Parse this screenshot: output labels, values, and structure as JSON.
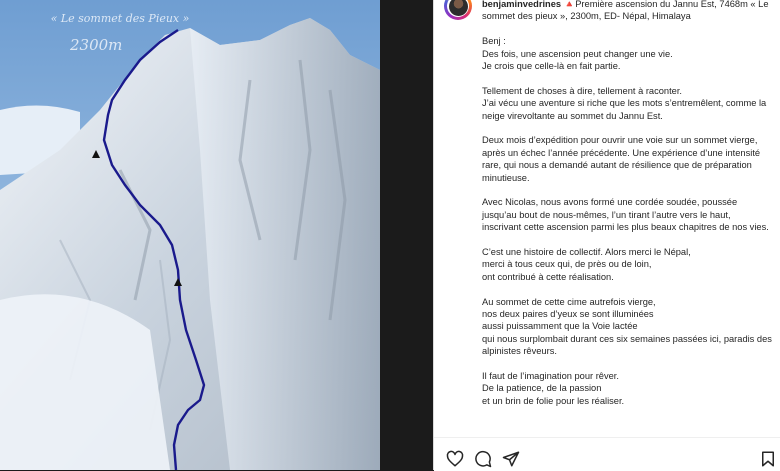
{
  "image": {
    "caption_top": "« Le sommet des Pieux »",
    "altitude_label": "2300m"
  },
  "post": {
    "username": "benjaminvedrines",
    "title_line": " 🔺Première ascension du Jannu Est, 7468m « Le sommet des pieux », 2300m, ED- Népal, Himalaya",
    "paragraphs": [
      "Benj :\nDes fois, une ascension peut changer une vie.\nJe crois que celle-là en fait partie.",
      "Tellement de choses à dire, tellement à raconter.\nJ’ai vécu une aventure si riche que les mots s’entremêlent, comme la neige virevoltante au sommet du Jannu Est.",
      "Deux mois d’expédition pour ouvrir une voie sur un sommet vierge, après un échec l’année précédente. Une expérience d’une intensité rare, qui nous a demandé autant de résilience que de préparation minutieuse.",
      "Avec Nicolas, nous avons formé une cordée soudée, poussée jusqu’au bout de nous-mêmes, l’un tirant l’autre vers le haut, inscrivant cette ascension parmi les plus beaux chapitres de nos vies.",
      "C’est une histoire de collectif. Alors merci le Népal,\nmerci à tous ceux qui, de près ou de loin,\nont contribué à cette réalisation.",
      "Au sommet de cette cime autrefois vierge,\nnos deux paires d’yeux se sont illuminées\naussi puissamment que la Voie lactée\nqui nous surplombait durant ces six semaines passées ici, paradis des alpinistes rêveurs.",
      "Il faut de l’imagination pour rêver.\nDe la patience, de la passion\net un brin de folie pour les réaliser."
    ]
  },
  "actions": {
    "like_icon": "heart-icon",
    "comment_icon": "comment-icon",
    "share_icon": "send-icon",
    "save_icon": "bookmark-icon"
  },
  "colors": {
    "route_line": "#1a1a8c",
    "text": "#262626"
  }
}
